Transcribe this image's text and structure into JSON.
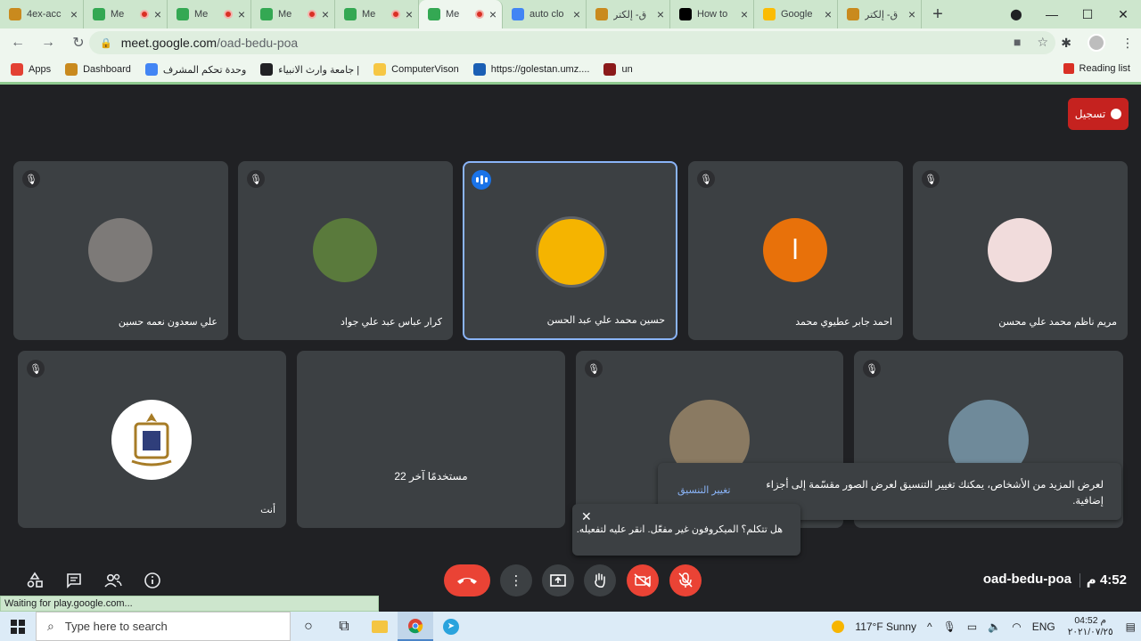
{
  "browser": {
    "tabs": [
      {
        "title": "4ex-acc",
        "fav_color": "#c98a1e",
        "recording": false,
        "active": false
      },
      {
        "title": "Me",
        "fav_color": "#34a853",
        "recording": true,
        "active": false
      },
      {
        "title": "Me",
        "fav_color": "#34a853",
        "recording": true,
        "active": false
      },
      {
        "title": "Me",
        "fav_color": "#34a853",
        "recording": true,
        "active": false
      },
      {
        "title": "Me",
        "fav_color": "#34a853",
        "recording": true,
        "active": false
      },
      {
        "title": "Me",
        "fav_color": "#34a853",
        "recording": true,
        "active": true
      },
      {
        "title": "auto clo",
        "fav_color": "#4285f4",
        "recording": false,
        "active": false
      },
      {
        "title": "ق- إلكتر",
        "fav_color": "#c98a1e",
        "recording": false,
        "active": false
      },
      {
        "title": "How to",
        "fav_color": "#000000",
        "recording": false,
        "active": false
      },
      {
        "title": "Google",
        "fav_color": "#fbbc04",
        "recording": false,
        "active": false
      },
      {
        "title": "ق- إلكتر",
        "fav_color": "#c98a1e",
        "recording": false,
        "active": false
      }
    ],
    "url_host": "meet.google.com",
    "url_path": "/oad-bedu-poa",
    "bookmarks": [
      {
        "label": "Apps",
        "icon_color": "#e34133"
      },
      {
        "label": "Dashboard",
        "icon_color": "#c98a1e"
      },
      {
        "label": "وحدة تحكم المشرف",
        "icon_color": "#4285f4"
      },
      {
        "label": "جامعة وارث الانبياء |",
        "icon_color": "#202124"
      },
      {
        "label": "ComputerVison",
        "icon_color": "#f6c744"
      },
      {
        "label": "https://golestan.umz....",
        "icon_color": "#1a5fb4"
      },
      {
        "label": "un",
        "icon_color": "#8b1a1a"
      }
    ],
    "reading_list": "Reading list"
  },
  "meet": {
    "recording_label": "تسجيل",
    "participants": [
      {
        "name": "علي سعدون نعمه حسين",
        "muted": true,
        "speaking": false,
        "avatar_color": "#7d7a78"
      },
      {
        "name": "كرار عباس عبد علي جواد",
        "muted": true,
        "speaking": false,
        "avatar_color": "#5a7a3c"
      },
      {
        "name": "حسين محمد علي عبد الحسن",
        "muted": false,
        "speaking": true,
        "avatar_color": "#f5b400"
      },
      {
        "name": "احمد جابر عطيوي محمد",
        "muted": true,
        "speaking": false,
        "avatar_color": "#e8710a",
        "initial": "ا"
      },
      {
        "name": "مريم ناظم محمد علي محسن",
        "muted": true,
        "speaking": false,
        "avatar_color": "#f1dcdc"
      },
      {
        "name": "أنت",
        "muted": true,
        "speaking": false,
        "avatar_color": "#ffffff"
      },
      {
        "name": "",
        "center_text": "22 مستخدمًا آخر"
      },
      {
        "name": "",
        "muted": true,
        "speaking": false,
        "avatar_color": "#8a7a62"
      },
      {
        "name": "",
        "muted": true,
        "speaking": false,
        "avatar_color": "#6f8a9a"
      }
    ],
    "layout_tip": {
      "message": "لعرض المزيد من الأشخاص، يمكنك تغيير التنسيق لعرض الصور مقسّمة إلى أجزاء إضافية.",
      "link": "تغيير التنسيق"
    },
    "mic_tip": "هل تتكلم؟ الميكروفون غير مفعّل. انقر عليه لتفعيله.",
    "meeting_code": "oad-bedu-poa",
    "time": "4:52 م"
  },
  "status_bar": "Waiting for play.google.com...",
  "taskbar": {
    "search_placeholder": "Type here to search",
    "weather": "117°F  Sunny",
    "language": "ENG",
    "clock_time": "04:52 م",
    "clock_date": "۲۰۲۱/۰۷/۲٥"
  }
}
